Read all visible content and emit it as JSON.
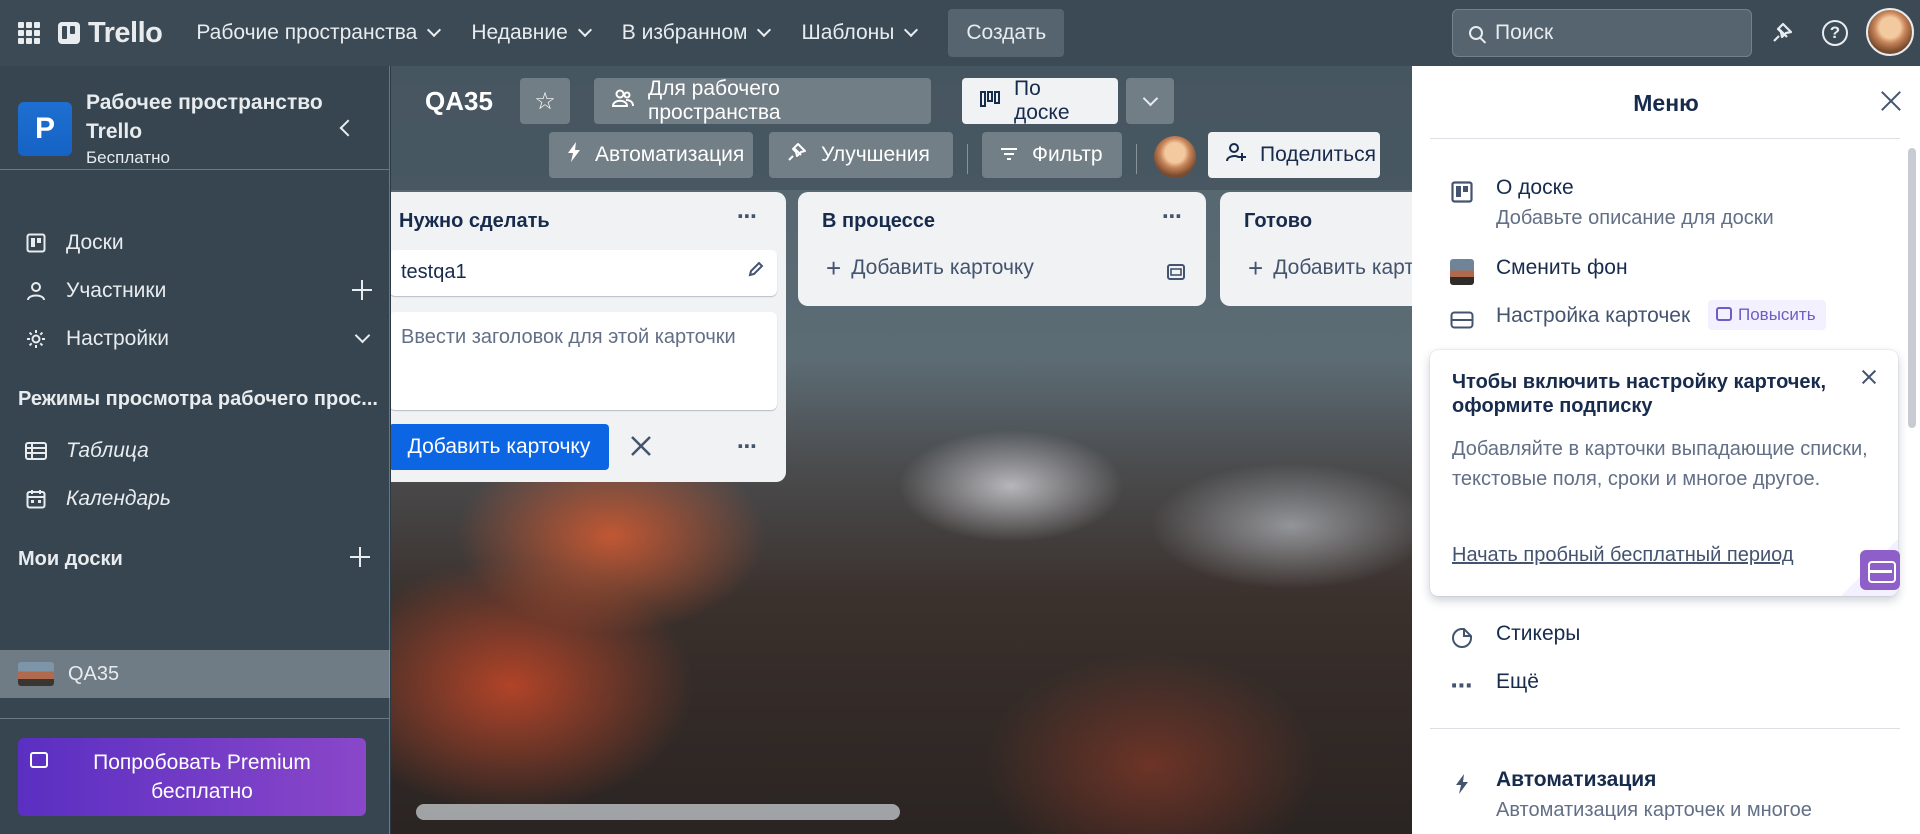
{
  "header": {
    "logo_text": "Trello",
    "nav": [
      {
        "label": "Рабочие пространства"
      },
      {
        "label": "Недавние"
      },
      {
        "label": "В избранном"
      },
      {
        "label": "Шаблоны"
      }
    ],
    "create_label": "Создать",
    "search_placeholder": "Поиск"
  },
  "sidebar": {
    "workspace_initial": "P",
    "workspace_name": "Рабочее пространство Trello",
    "workspace_plan": "Бесплатно",
    "items": [
      {
        "label": "Доски"
      },
      {
        "label": "Участники"
      },
      {
        "label": "Настройки"
      }
    ],
    "views_heading": "Режимы просмотра рабочего прос...",
    "views": [
      {
        "label": "Таблица"
      },
      {
        "label": "Календарь"
      }
    ],
    "my_boards_heading": "Мои доски",
    "boards": [
      {
        "label": "QA35"
      }
    ],
    "premium_label": "Попробовать Premium бесплатно"
  },
  "board": {
    "title": "QA35",
    "visibility_label": "Для рабочего пространства",
    "view_label": "По доске",
    "automation_label": "Автоматизация",
    "powerups_label": "Улучшения",
    "filter_label": "Фильтр",
    "share_label": "Поделиться",
    "lists": [
      {
        "title": "Нужно сделать",
        "cards": [
          {
            "title": "testqa1"
          }
        ],
        "composer_placeholder": "Ввести заголовок для этой карточки",
        "add_button": "Добавить карточку"
      },
      {
        "title": "В процессе",
        "add_card": "Добавить карточку"
      },
      {
        "title": "Готово",
        "add_card": "Добавить карт"
      }
    ]
  },
  "menu": {
    "title": "Меню",
    "about_label": "О доске",
    "about_sub": "Добавьте описание для доски",
    "background_label": "Сменить фон",
    "card_settings_label": "Настройка карточек",
    "upgrade_badge": "Повысить",
    "promo": {
      "title": "Чтобы включить настройку карточек, оформите подписку",
      "body": "Добавляйте в карточки выпадающие списки, текстовые поля, сроки и многое другое.",
      "link": "Начать пробный бесплатный период"
    },
    "stickers_label": "Стикеры",
    "more_label": "Ещё",
    "automation_label": "Автоматизация",
    "automation_sub": "Автоматизация карточек и многое"
  }
}
